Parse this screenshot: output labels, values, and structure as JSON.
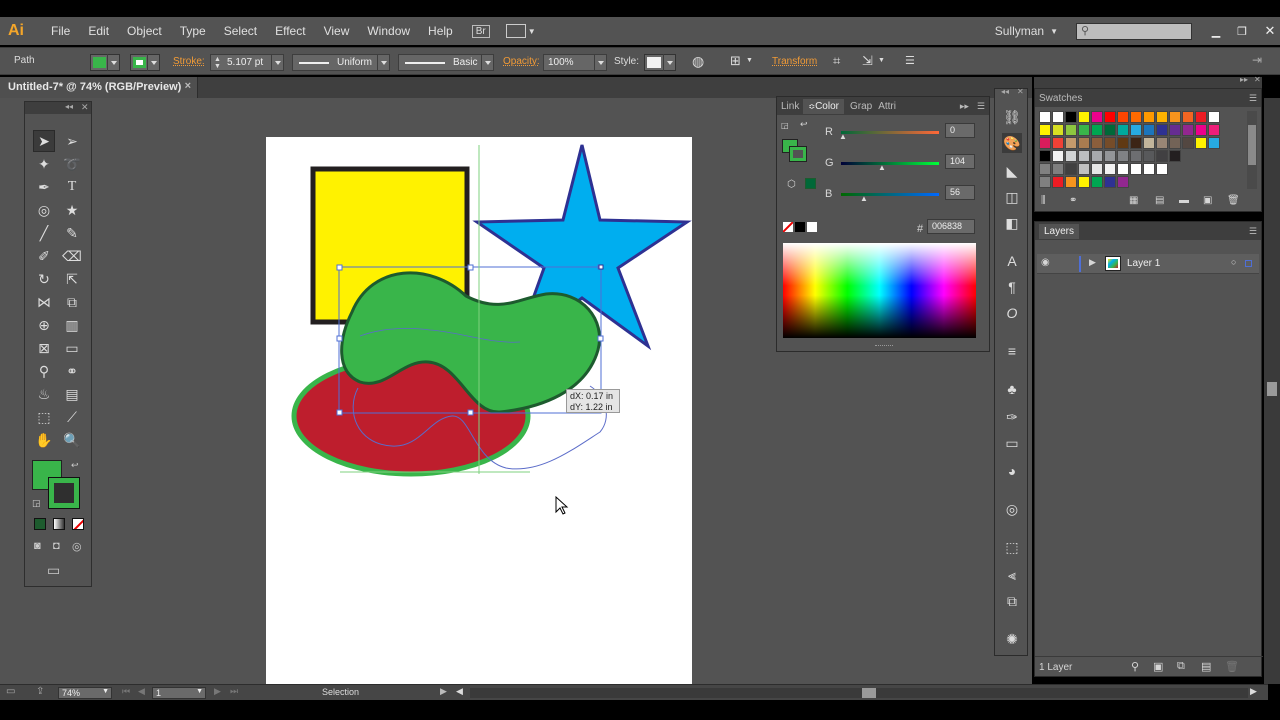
{
  "app": {
    "logo": "Ai"
  },
  "menu": [
    "File",
    "Edit",
    "Object",
    "Type",
    "Select",
    "Effect",
    "View",
    "Window",
    "Help"
  ],
  "bridge_btn": "Br",
  "workspace": "Sullyman",
  "search": {
    "placeholder": ""
  },
  "control": {
    "selection_type": "Path",
    "stroke_label": "Stroke:",
    "stroke_weight": "5.107 pt",
    "profile": "Uniform",
    "brush": "Basic",
    "opacity_label": "Opacity:",
    "opacity_value": "100%",
    "style_label": "Style:",
    "transform_label": "Transform",
    "fill_color": "#39b54a",
    "stroke_color": "#39b54a"
  },
  "document": {
    "tab_title": "Untitled-7* @ 74% (RGB/Preview)",
    "close": "×"
  },
  "smart_guide": {
    "dx": "dX: 0.17 in",
    "dy": "dY: 1.22 in"
  },
  "color_panel": {
    "tabs": [
      "Link",
      "Color",
      "Grap",
      "Attri"
    ],
    "r_label": "R",
    "r_value": "0",
    "g_label": "G",
    "g_value": "104",
    "b_label": "B",
    "b_value": "56",
    "hex_label": "#",
    "hex_value": "006838"
  },
  "swatches_panel": {
    "title": "Swatches"
  },
  "layers_panel": {
    "title": "Layers",
    "layer_name": "Layer 1",
    "layer_count": "1 Layer"
  },
  "status": {
    "zoom": "74%",
    "page": "1",
    "tool": "Selection"
  },
  "colors": {
    "yellow": "#fff200",
    "blue": "#00aeef",
    "green": "#39b54a",
    "red": "#be1e2d"
  }
}
